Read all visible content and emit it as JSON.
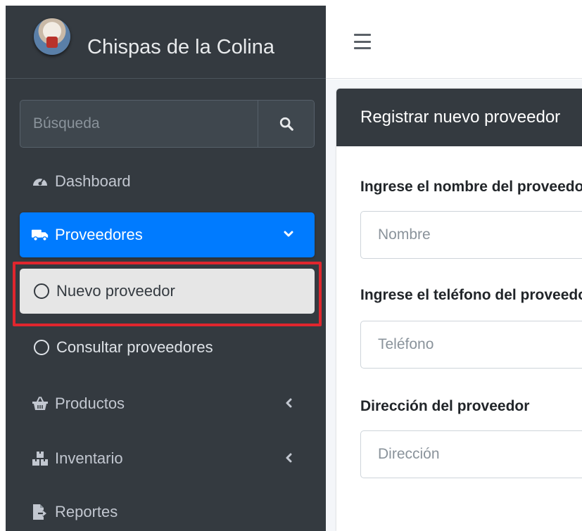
{
  "brand": {
    "name": "Chispas de la Colina"
  },
  "search": {
    "placeholder": "Búsqueda",
    "button_icon": "search-icon"
  },
  "sidebar": {
    "items": [
      {
        "label": "Dashboard",
        "icon": "dashboard-icon"
      },
      {
        "label": "Proveedores",
        "icon": "truck-icon",
        "active": true
      },
      {
        "label": "Nuevo proveedor",
        "icon": "circle-icon",
        "active": true
      },
      {
        "label": "Consultar proveedores",
        "icon": "circle-icon"
      },
      {
        "label": "Productos",
        "icon": "basket-icon"
      },
      {
        "label": "Inventario",
        "icon": "boxes-icon"
      },
      {
        "label": "Reportes",
        "icon": "file-export-icon"
      }
    ]
  },
  "colors": {
    "sidebar_bg": "#343a40",
    "active_bg": "#007bff",
    "highlight": "#e0262e"
  },
  "card": {
    "title": "Registrar nuevo proveedor",
    "fields": [
      {
        "label": "Ingrese el nombre del proveedor",
        "placeholder": "Nombre"
      },
      {
        "label": "Ingrese el teléfono del proveedor",
        "placeholder": "Teléfono"
      },
      {
        "label": "Dirección del proveedor",
        "placeholder": "Dirección"
      }
    ]
  }
}
